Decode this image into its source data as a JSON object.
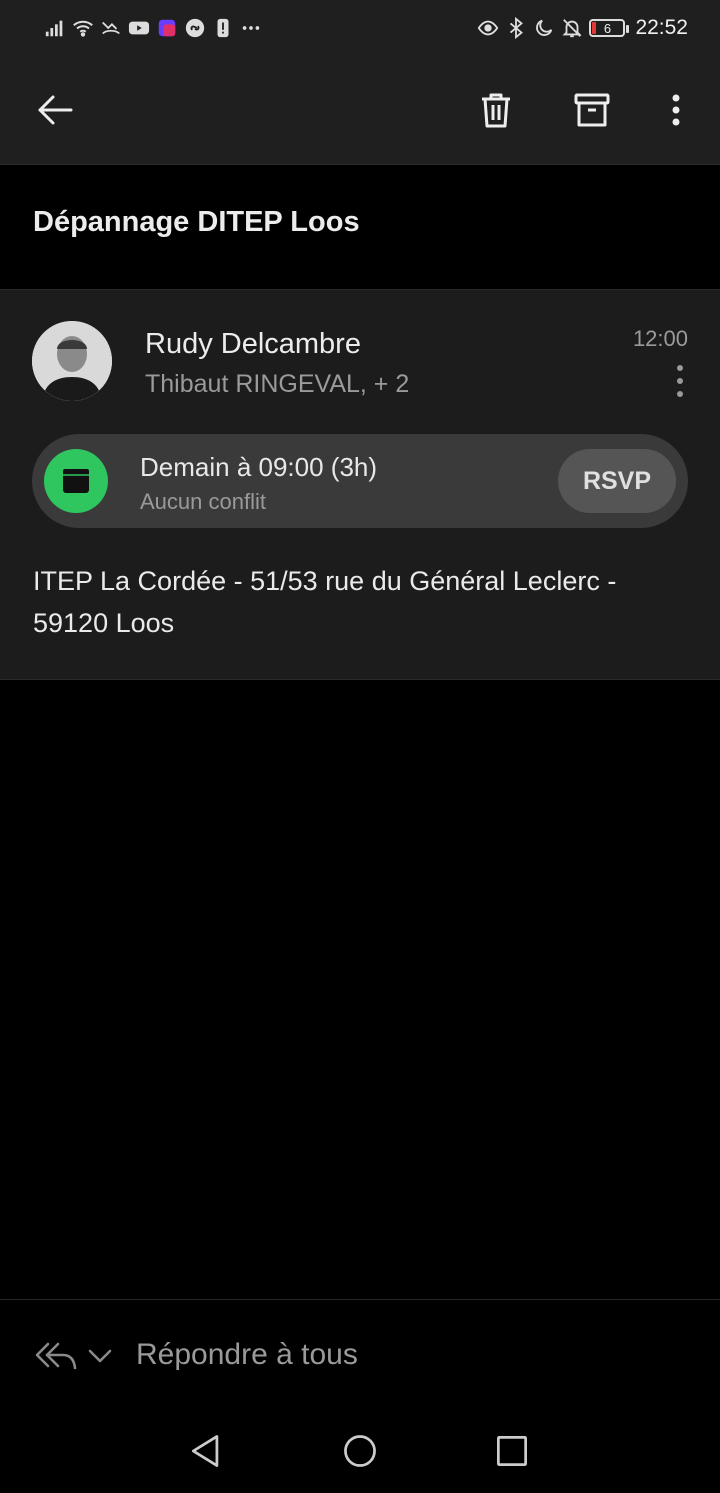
{
  "status_bar": {
    "time": "22:52",
    "battery_level": "6",
    "left_icons": [
      "signal-icon",
      "wifi-icon",
      "missed-call-icon",
      "youtube-icon",
      "app-icon",
      "shazam-icon",
      "alert-icon",
      "more-dots-icon"
    ],
    "right_icons": [
      "eye-icon",
      "bluetooth-icon",
      "moon-icon",
      "bell-off-icon"
    ]
  },
  "toolbar": {
    "back_icon": "arrow-left-icon",
    "delete_icon": "trash-icon",
    "archive_icon": "archive-icon",
    "menu_icon": "more-vert-icon"
  },
  "email": {
    "subject": "Dépannage DITEP Loos",
    "sender": "Rudy Delcambre",
    "recipients": "Thibaut RINGEVAL, + 2",
    "time": "12:00",
    "event": {
      "title": "Demain à 09:00 (3h)",
      "subtitle": "Aucun conflit",
      "rsvp_label": "RSVP",
      "accent": "#2fc660"
    },
    "body": "ITEP La Cordée - 51/53 rue du Général Leclerc - 59120 Loos"
  },
  "reply": {
    "label": "Répondre à tous"
  },
  "colors": {
    "background": "#000000",
    "surface": "#1c1c1c",
    "chip": "#3a3a3a"
  }
}
